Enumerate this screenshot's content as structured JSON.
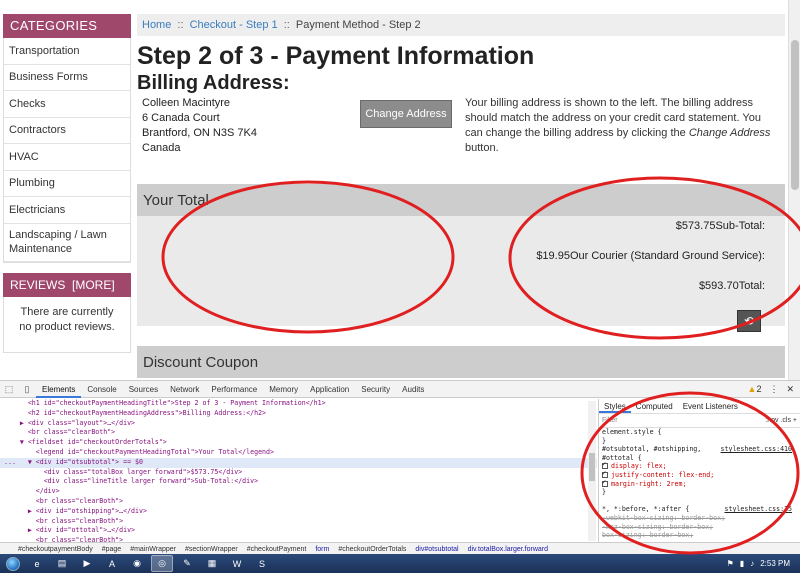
{
  "breadcrumb": {
    "home": "Home",
    "sep": "::",
    "checkout": "Checkout - Step 1",
    "current": "Payment Method - Step 2"
  },
  "sidebar": {
    "categories_title": "CATEGORIES",
    "items": [
      "Transportation",
      "Business Forms",
      "Checks",
      "Contractors",
      "HVAC",
      "Plumbing",
      "Electricians",
      "Landscaping / Lawn Maintenance"
    ],
    "reviews_title": "REVIEWS",
    "reviews_more": "[MORE]",
    "reviews_text": "There are currently no product reviews."
  },
  "main": {
    "heading": "Step 2 of 3 - Payment Information",
    "billing_heading": "Billing Address:",
    "address": [
      "Colleen Macintyre",
      "6 Canada Court",
      "Brantford, ON N3S 7K4",
      "Canada"
    ],
    "change_address_label": "Change Address",
    "billing_note_pre": "Your billing address is shown to the left. The billing address should match the address on your credit card statement. You can change the billing address by clicking the ",
    "billing_note_em": "Change Address",
    "billing_note_post": " button.",
    "total_legend": "Your Total",
    "subtotal_value": "$573.75",
    "subtotal_label": "Sub-Total:",
    "shipping_value": "$19.95",
    "shipping_label": "Our Courier (Standard Ground Service):",
    "total_value": "$593.70",
    "total_label": "Total:",
    "coupon_legend": "Discount Coupon"
  },
  "devtools": {
    "tabs": [
      "Elements",
      "Console",
      "Sources",
      "Network",
      "Performance",
      "Memory",
      "Application",
      "Security",
      "Audits"
    ],
    "active_tab": "Elements",
    "warning_count": "2",
    "dom_lines": [
      {
        "indent": "      ",
        "text": "<h1 id=\"checkoutPaymentHeadingTitle\">Step 2 of 3 - Payment Information</h1>",
        "selected": false
      },
      {
        "indent": "      ",
        "text": "<h2 id=\"checkoutPaymentHeadingAddress\">Billing Address:</h2>",
        "selected": false
      },
      {
        "indent": "    ▶ ",
        "text": "<div class=\"layout\">…</div>",
        "selected": false
      },
      {
        "indent": "      ",
        "text": "<br class=\"clearBoth\">",
        "selected": false
      },
      {
        "indent": "    ▼ ",
        "text": "<fieldset id=\"checkoutOrderTotals\">",
        "selected": false
      },
      {
        "indent": "        ",
        "text": "<legend id=\"checkoutPaymentHeadingTotal\">Your Total</legend>",
        "selected": false
      },
      {
        "indent": "...   ▼ ",
        "text": "<div id=\"otsubtotal\"> == $0",
        "selected": true
      },
      {
        "indent": "          ",
        "text": "<div class=\"totalBox larger forward\">$573.75</div>",
        "selected": false
      },
      {
        "indent": "          ",
        "text": "<div class=\"lineTitle larger forward\">Sub-Total:</div>",
        "selected": false
      },
      {
        "indent": "        ",
        "text": "</div>",
        "selected": false
      },
      {
        "indent": "        ",
        "text": "<br class=\"clearBoth\">",
        "selected": false
      },
      {
        "indent": "      ▶ ",
        "text": "<div id=\"otshipping\">…</div>",
        "selected": false
      },
      {
        "indent": "        ",
        "text": "<br class=\"clearBoth\">",
        "selected": false
      },
      {
        "indent": "      ▶ ",
        "text": "<div id=\"ottotal\">…</div>",
        "selected": false
      },
      {
        "indent": "        ",
        "text": "<br class=\"clearBoth\">",
        "selected": false
      }
    ],
    "styles_tabs": [
      "Styles",
      "Computed",
      "Event Listeners"
    ],
    "filter_placeholder": "Filter",
    "filter_right": ":hov  .cls  +",
    "style_lines": [
      {
        "text": "element.style {",
        "kind": "plain"
      },
      {
        "text": "}",
        "kind": "plain"
      },
      {
        "text": "#otsubtotal, #otshipping,",
        "kind": "selector",
        "link": "stylesheet.css:410"
      },
      {
        "text": "#ottotal {",
        "kind": "plain"
      },
      {
        "text": "display: flex;",
        "kind": "prop"
      },
      {
        "text": "justify-content: flex-end;",
        "kind": "prop"
      },
      {
        "text": "margin-right: 2rem;",
        "kind": "prop"
      },
      {
        "text": "}",
        "kind": "plain"
      },
      {
        "text": "",
        "kind": "plain"
      },
      {
        "text": "*, *:before, *:after {",
        "kind": "selector",
        "link": "stylesheet.css:15"
      },
      {
        "text": "-webkit-box-sizing: border-box;",
        "kind": "strike"
      },
      {
        "text": "-moz-box-sizing: border-box;",
        "kind": "strike"
      },
      {
        "text": "box-sizing: border-box;",
        "kind": "strike"
      }
    ],
    "breadcrumb_nodes": [
      "#checkoutpaymentBody",
      "#page",
      "#mainWrapper",
      "#sectionWrapper",
      "#checkoutPayment",
      "form",
      "#checkoutOrderTotals",
      "div#otsubtotal",
      "div.totalBox.larger.forward"
    ]
  },
  "taskbar": {
    "clock": "2:53 PM",
    "apps": [
      "ie-icon",
      "folder-icon",
      "media-icon",
      "pdf-icon",
      "firefox-icon",
      "chrome-icon",
      "paint-icon",
      "calc-icon",
      "word-icon",
      "skype-icon"
    ]
  },
  "colors": {
    "category_header": "#a0486c",
    "annotation": "#e02020",
    "link": "#3a7dbf"
  }
}
